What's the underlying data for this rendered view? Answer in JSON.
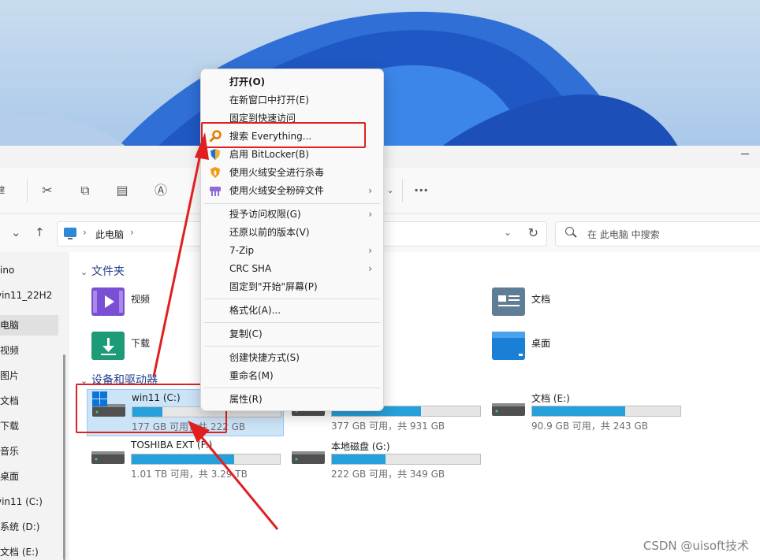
{
  "context_menu": {
    "items": [
      {
        "label": "打开(O)",
        "bold": true
      },
      {
        "label": "在新窗口中打开(E)"
      },
      {
        "label": "固定到快速访问"
      },
      {
        "label": "搜索 Everything...",
        "icon": "everything-search-icon"
      },
      {
        "label": "启用 BitLocker(B)",
        "icon": "shield-icon"
      },
      {
        "label": "使用火绒安全进行杀毒",
        "icon": "huorong-shield-icon"
      },
      {
        "label": "使用火绒安全粉碎文件",
        "icon": "shredder-icon",
        "submenu": true
      },
      {
        "label": "授予访问权限(G)",
        "submenu": true
      },
      {
        "label": "还原以前的版本(V)"
      },
      {
        "label": "7-Zip",
        "submenu": true
      },
      {
        "label": "CRC SHA",
        "submenu": true
      },
      {
        "label": "固定到\"开始\"屏幕(P)"
      },
      {
        "label": "格式化(A)..."
      },
      {
        "label": "复制(C)"
      },
      {
        "label": "创建快捷方式(S)"
      },
      {
        "label": "重命名(M)"
      },
      {
        "label": "属性(R)"
      }
    ]
  },
  "address_bar": {
    "path": "此电脑",
    "search_placeholder": "在 此电脑 中搜索"
  },
  "sidebar": {
    "items": [
      {
        "label": "ino"
      },
      {
        "label": "vin11_22H2"
      },
      {
        "label": "电脑",
        "selected": true
      },
      {
        "label": "视频"
      },
      {
        "label": "图片"
      },
      {
        "label": "文档"
      },
      {
        "label": "下载"
      },
      {
        "label": "音乐"
      },
      {
        "label": "桌面"
      },
      {
        "label": "vin11 (C:)"
      },
      {
        "label": "系统 (D:)"
      },
      {
        "label": "文档 (E:)"
      }
    ]
  },
  "folders_section": {
    "header": "文件夹",
    "items": [
      {
        "label": "视频",
        "color": "#7b4fd4"
      },
      {
        "label": "文档",
        "color": "#5f7d95"
      },
      {
        "label": "下载",
        "color": "#1d9a78"
      },
      {
        "label": "桌面",
        "color": "#1a7fd6"
      }
    ]
  },
  "drives_section": {
    "header": "设备和驱动器",
    "drives": [
      {
        "name": "win11 (C:)",
        "free_text": "177 GB 可用，共 222 GB",
        "used_fraction": 0.2,
        "selected": true
      },
      {
        "name": "",
        "free_text": "377 GB 可用，共 931 GB",
        "used_fraction": 0.6
      },
      {
        "name": "文档 (E:)",
        "free_text": "90.9 GB 可用，共 243 GB",
        "used_fraction": 0.63
      },
      {
        "name": "TOSHIBA EXT (F:)",
        "free_text": "1.01 TB 可用，共 3.29 TB",
        "used_fraction": 0.69
      },
      {
        "name": "本地磁盘 (G:)",
        "free_text": "222 GB 可用，共 349 GB",
        "used_fraction": 0.36
      }
    ]
  },
  "watermark": "CSDN @uisoft技术",
  "colors": {
    "accent": "#26a0da",
    "annotation": "#e02020",
    "selection": "#cce4f7"
  }
}
